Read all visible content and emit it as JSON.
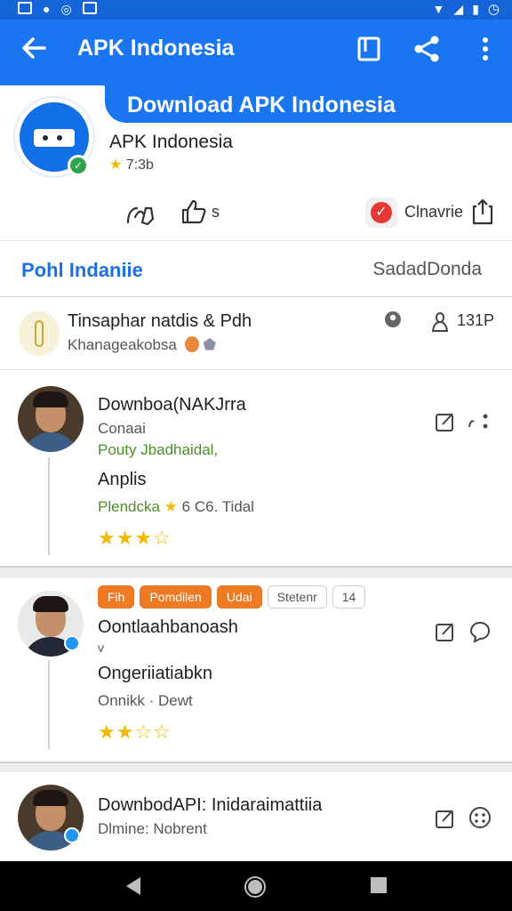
{
  "app_bar": {
    "title": "APK Indonesia"
  },
  "banner": {
    "text": "Download APK Indonesia"
  },
  "app_info": {
    "name": "APK Indonesia",
    "rating": "7:3b"
  },
  "actions": {
    "share_label": "s",
    "channel_label": "Clnavrie"
  },
  "tabs": {
    "left": "Pohl Indaniie",
    "right": "SadadDonda"
  },
  "feature": {
    "title": "Tinsaphar natdis & Pdh",
    "subtitle": "Khanageakobsa",
    "count": "131P"
  },
  "reviews": [
    {
      "name": "Downboa(NAKJrra",
      "subtitle": "Conaai",
      "green_line": "Pouty Jbadhaidal,",
      "body": "Anplis",
      "meta": "Plendcka",
      "meta_extra": "6 C6. Tidal",
      "stars": "★★★☆"
    },
    {
      "chips": [
        "Fih",
        "Pomdilen",
        "Udai",
        "Stetenr",
        "14"
      ],
      "name": "Oontlaahbanoash",
      "line2": "v",
      "body": "Ongeriiatiabkn",
      "meta": "Onnikk · Dewt",
      "stars": "★★☆☆"
    },
    {
      "name": "DownbodAPI: Inidaraimattiia",
      "subtitle": "Dlmine: Nobrent"
    }
  ],
  "colors": {
    "primary": "#1976f0",
    "status_bar": "#1565d8",
    "accent_orange": "#ef7a23",
    "star": "#f5b800",
    "verify_green": "#2ea44f"
  }
}
